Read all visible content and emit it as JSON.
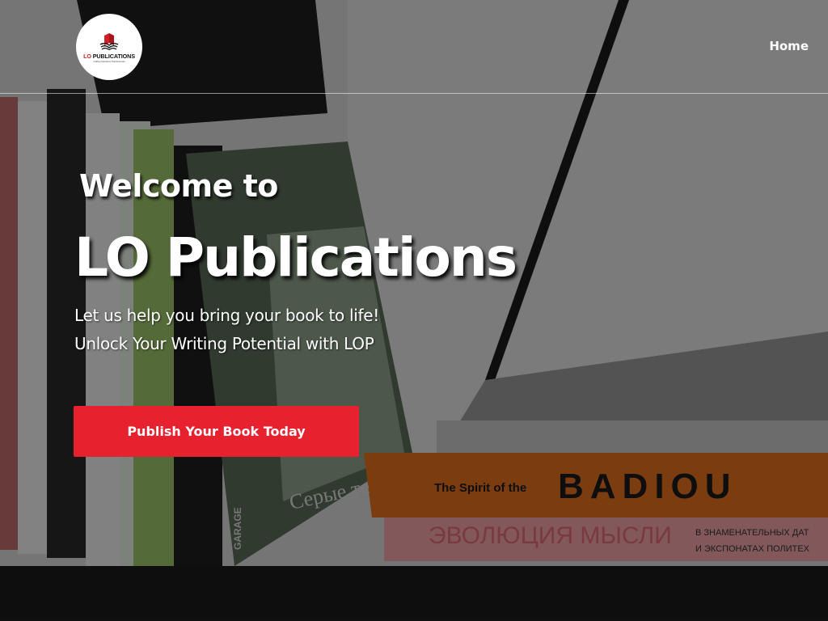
{
  "header": {
    "logo": {
      "name_prefix": "LO",
      "name_suffix": " PUBLICATIONS",
      "tagline": "Crafting Narratives That Resonate",
      "icon": "open-book-icon",
      "accent": "#d21f26"
    },
    "nav": [
      {
        "label": "Home"
      }
    ]
  },
  "hero": {
    "welcome": "Welcome to",
    "title": "LO Publications",
    "tagline_lines": [
      "Let us help you bring your book to life!",
      "Unlock Your Writing Potential with LOP"
    ],
    "cta_label": "Publish Your Book Today",
    "cta_color": "#e8212e",
    "background": "bookshelf-photo"
  },
  "background_book_text": {
    "spine_1": "The Spirit of the",
    "spine_2": "BADIOU",
    "spine_3": "ЭВОЛЮЦИЯ МЫСЛИ",
    "spine_4": "В ЗНАМЕНАТЕЛЬНЫХ ДАТ",
    "spine_5": "И ЭКСПОНАТАХ ПОЛИТЕХ",
    "cover_text": "Серые те",
    "garage_text": "GARAGE"
  }
}
